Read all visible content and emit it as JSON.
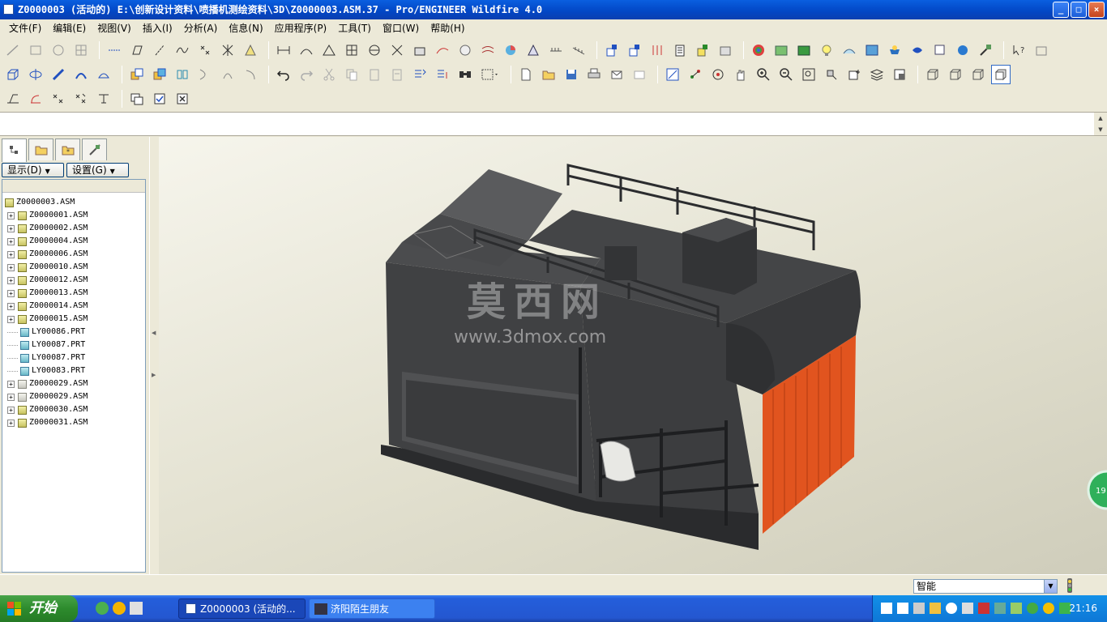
{
  "window": {
    "title": "Z0000003 (活动的) E:\\创新设计资料\\喷播机测绘资料\\3D\\Z0000003.ASM.37 - Pro/ENGINEER Wildfire 4.0",
    "controls": {
      "minimize": "_",
      "maximize": "□",
      "close": "×"
    }
  },
  "menu": [
    "文件(F)",
    "编辑(E)",
    "视图(V)",
    "插入(I)",
    "分析(A)",
    "信息(N)",
    "应用程序(P)",
    "工具(T)",
    "窗口(W)",
    "帮助(H)"
  ],
  "nav": {
    "show_button": "显示(D)",
    "settings_button": "设置(G)",
    "tree": [
      {
        "label": "Z0000003.ASM",
        "type": "asm",
        "root": true
      },
      {
        "label": "Z0000001.ASM",
        "type": "asm"
      },
      {
        "label": "Z0000002.ASM",
        "type": "asm"
      },
      {
        "label": "Z0000004.ASM",
        "type": "asm"
      },
      {
        "label": "Z0000006.ASM",
        "type": "asm"
      },
      {
        "label": "Z0000010.ASM",
        "type": "asm"
      },
      {
        "label": "Z0000012.ASM",
        "type": "asm"
      },
      {
        "label": "Z0000013.ASM",
        "type": "asm"
      },
      {
        "label": "Z0000014.ASM",
        "type": "asm"
      },
      {
        "label": "Z0000015.ASM",
        "type": "asm"
      },
      {
        "label": "LY00086.PRT",
        "type": "prt"
      },
      {
        "label": "LY00087.PRT",
        "type": "prt"
      },
      {
        "label": "LY00087.PRT",
        "type": "prt"
      },
      {
        "label": "LY00083.PRT",
        "type": "prt"
      },
      {
        "label": "Z0000029.ASM",
        "type": "asm-gray"
      },
      {
        "label": "Z0000029.ASM",
        "type": "asm-gray"
      },
      {
        "label": "Z0000030.ASM",
        "type": "asm"
      },
      {
        "label": "Z0000031.ASM",
        "type": "asm"
      }
    ]
  },
  "viewport": {
    "watermark_title": "莫西网",
    "watermark_url": "www.3dmox.com",
    "side_badge": "19"
  },
  "status": {
    "filter_value": "智能"
  },
  "taskbar": {
    "start_label": "开始",
    "tasks": [
      "Z0000003 (活动的...",
      "济阳陌生朋友"
    ],
    "clock": "21:16"
  },
  "colors": {
    "accent_orange": "#e1541f",
    "model_dark": "#3c3d3f",
    "title_blue": "#0246c4",
    "taskbar_blue": "#245edb"
  }
}
